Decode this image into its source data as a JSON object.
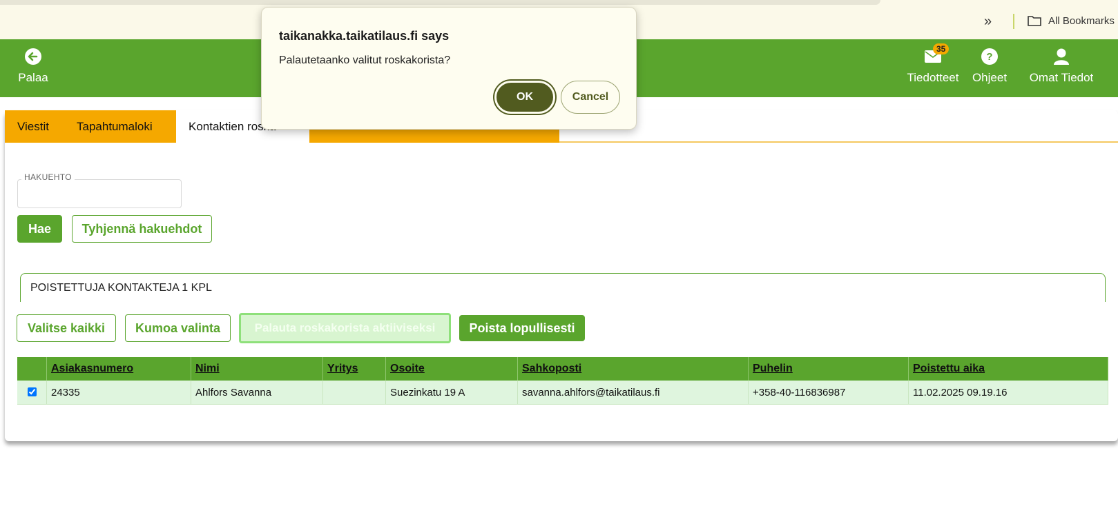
{
  "browser": {
    "more_glyph": "»",
    "bookmarks_label": "All Bookmarks"
  },
  "header": {
    "back_label": "Palaa",
    "notices_label": "Tiedotteet",
    "notices_count": "35",
    "help_label": "Ohjeet",
    "profile_label": "Omat Tiedot"
  },
  "tabs": [
    {
      "label": "Viestit"
    },
    {
      "label": "Tapahtumaloki"
    },
    {
      "label": "Kontaktien roska"
    }
  ],
  "search": {
    "label": "HAKUEHTO",
    "value": "",
    "search_button": "Hae",
    "clear_button": "Tyhjennä hakuehdot"
  },
  "summary": "POISTETTUJA KONTAKTEJA 1 KPL",
  "actions": {
    "select_all": "Valitse kaikki",
    "deselect": "Kumoa valinta",
    "restore": "Palauta roskakorista aktiiviseksi",
    "delete_permanently": "Poista lopullisesti"
  },
  "table": {
    "columns": [
      "Asiakasnumero",
      "Nimi",
      "Yritys",
      "Osoite",
      "Sahkoposti",
      "Puhelin",
      "Poistettu aika"
    ],
    "rows": [
      {
        "checked": true,
        "cells": [
          "24335",
          "Ahlfors Savanna",
          "",
          "Suezinkatu 19 A",
          "savanna.ahlfors@taikatilaus.fi",
          "+358-40-116836987",
          "11.02.2025 09.19.16"
        ]
      }
    ]
  },
  "dialog": {
    "title": "taikanakka.taikatilaus.fi says",
    "message": "Palautetaanko valitut roskakorista?",
    "ok": "OK",
    "cancel": "Cancel"
  },
  "colors": {
    "brand_green": "#5aa52d",
    "tab_orange": "#f5a800",
    "dialog_ok": "#515b1f"
  }
}
